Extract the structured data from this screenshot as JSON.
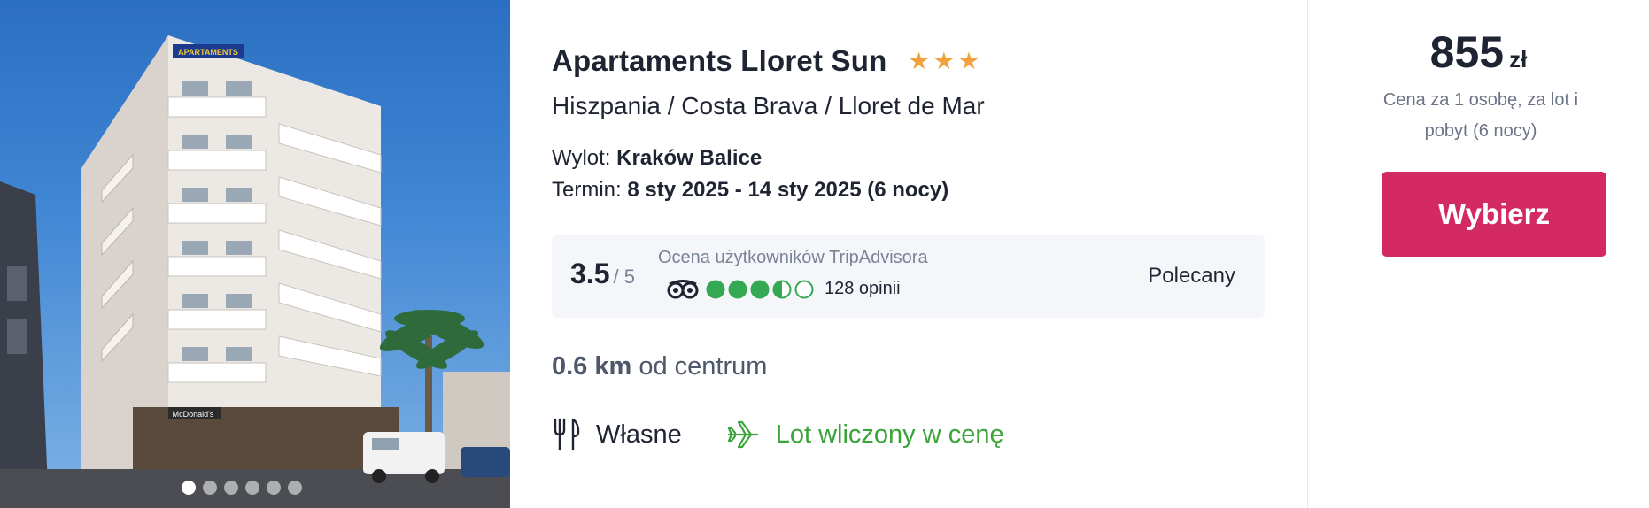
{
  "photo": {
    "alt_sign": "APARTAMENTS",
    "slides_total": 6,
    "active_slide": 1
  },
  "hotel": {
    "name": "Apartaments Lloret Sun",
    "stars": 3,
    "location": "Hiszpania / Costa Brava / Lloret de Mar"
  },
  "flight": {
    "label": "Wylot:",
    "value": "Kraków Balice"
  },
  "term": {
    "label": "Termin:",
    "value": "8 sty 2025 - 14 sty 2025 (6 nocy)"
  },
  "rating": {
    "score": "3.5",
    "max": "/ 5",
    "source_label": "Ocena użytkowników TripAdvisora",
    "bubbles_value": 3.5,
    "bubbles_total": 5,
    "reviews": "128 opinii",
    "badge": "Polecany"
  },
  "distance": {
    "value": "0.6 km",
    "label": "od centrum"
  },
  "features": {
    "board": "Własne",
    "flight_included": "Lot wliczony w cenę"
  },
  "price": {
    "amount": "855",
    "currency": "zł",
    "note": "Cena za 1 osobę, za lot i pobyt (6 nocy)"
  },
  "actions": {
    "select_label": "Wybierz"
  },
  "colors": {
    "accent": "#d42a63",
    "star": "#f3a03c",
    "tripadvisor_green": "#34a853",
    "success_text": "#3aa33a"
  }
}
